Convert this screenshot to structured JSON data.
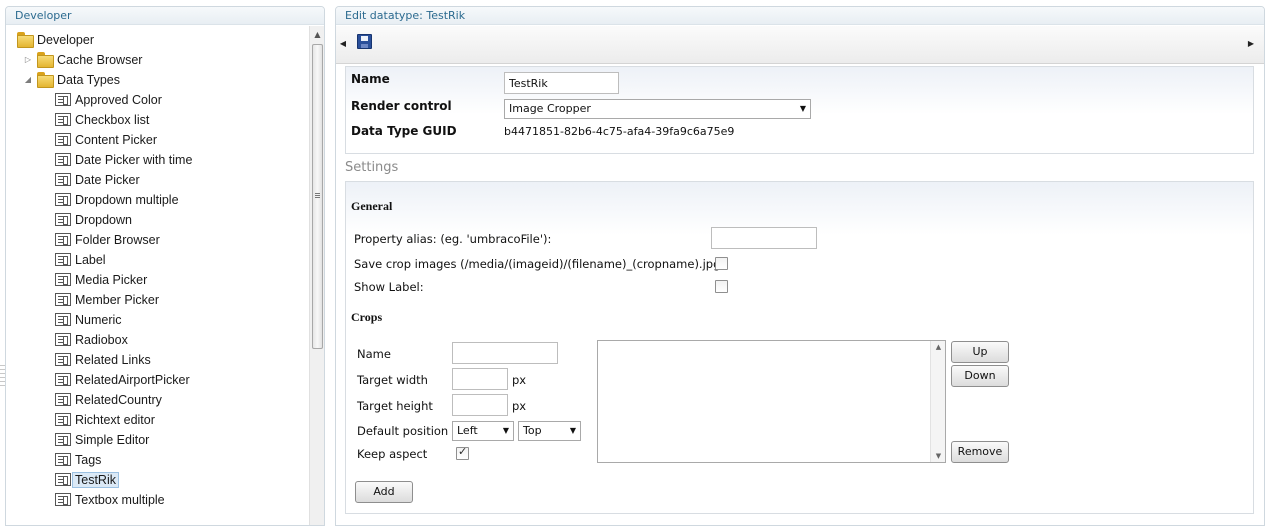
{
  "left_panel": {
    "title": "Developer",
    "tree": {
      "root": "Developer",
      "cache_browser": "Cache Browser",
      "data_types": "Data Types",
      "items": [
        "Approved Color",
        "Checkbox list",
        "Content Picker",
        "Date Picker with time",
        "Date Picker",
        "Dropdown multiple",
        "Dropdown",
        "Folder Browser",
        "Label",
        "Media Picker",
        "Member Picker",
        "Numeric",
        "Radiobox",
        "Related Links",
        "RelatedAirportPicker",
        "RelatedCountry",
        "Richtext editor",
        "Simple Editor",
        "Tags",
        "TestRik",
        "Textbox multiple"
      ],
      "selected": "TestRik"
    }
  },
  "right_panel": {
    "title": "Edit datatype: TestRik",
    "properties": {
      "name_label": "Name",
      "name_value": "TestRik",
      "render_control_label": "Render control",
      "render_control_value": "Image Cropper",
      "guid_label": "Data Type GUID",
      "guid_value": "b4471851-82b6-4c75-afa4-39fa9c6a75e9"
    },
    "settings": {
      "title": "Settings",
      "general_title": "General",
      "property_alias_label": "Property alias: (eg. 'umbracoFile'):",
      "property_alias_value": "",
      "save_crop_label": "Save crop images (/media/(imageid)/(filename)_(cropname).jpg):",
      "save_crop_checked": false,
      "show_label_label": "Show Label:",
      "show_label_checked": false,
      "crops_title": "Crops",
      "crop_name_label": "Name",
      "target_width_label": "Target width",
      "target_height_label": "Target height",
      "px_unit": "px",
      "default_position_label": "Default position",
      "position_horizontal": "Left",
      "position_vertical": "Top",
      "keep_aspect_label": "Keep aspect",
      "keep_aspect_checked": true,
      "up_label": "Up",
      "down_label": "Down",
      "remove_label": "Remove",
      "add_label": "Add"
    }
  },
  "colors": {
    "header_text": "#2b6a8f",
    "selection_bg": "#dbe9f6",
    "folder_yellow": "#e4b531",
    "save_icon_blue": "#2a4f9a"
  }
}
